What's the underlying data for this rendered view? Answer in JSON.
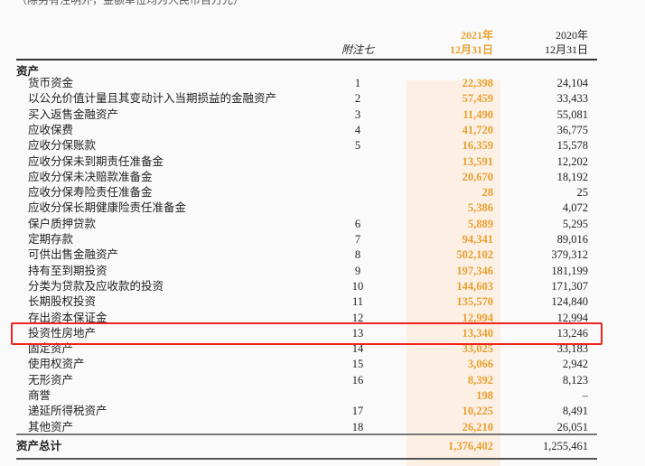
{
  "note": "（除另有注明外，金额单位均为人民币百万元）",
  "header": {
    "note_col": "附注七",
    "y2021": "2021年",
    "d2021": "12月31日",
    "y2020": "2020年",
    "d2020": "12月31日"
  },
  "section": "资产",
  "rows": [
    [
      "货币资金",
      "1",
      "22,398",
      "24,104"
    ],
    [
      "以公允价值计量且其变动计入当期损益的金融资产",
      "2",
      "57,459",
      "33,433"
    ],
    [
      "买入返售金融资产",
      "3",
      "11,490",
      "55,081"
    ],
    [
      "应收保费",
      "4",
      "41,720",
      "36,775"
    ],
    [
      "应收分保账款",
      "5",
      "16,359",
      "15,578"
    ],
    [
      "应收分保未到期责任准备金",
      "",
      "13,591",
      "12,202"
    ],
    [
      "应收分保未决赔款准备金",
      "",
      "20,670",
      "18,192"
    ],
    [
      "应收分保寿险责任准备金",
      "",
      "28",
      "25"
    ],
    [
      "应收分保长期健康险责任准备金",
      "",
      "5,386",
      "4,072"
    ],
    [
      "保户质押贷款",
      "6",
      "5,889",
      "5,295"
    ],
    [
      "定期存款",
      "7",
      "94,341",
      "89,016"
    ],
    [
      "可供出售金融资产",
      "8",
      "502,102",
      "379,312"
    ],
    [
      "持有至到期投资",
      "9",
      "197,346",
      "181,199"
    ],
    [
      "分类为贷款及应收款的投资",
      "10",
      "144,603",
      "171,307"
    ],
    [
      "长期股权投资",
      "11",
      "135,570",
      "124,840"
    ],
    [
      "存出资本保证金",
      "12",
      "12,994",
      "12,994"
    ],
    [
      "投资性房地产",
      "13",
      "13,340",
      "13,246"
    ],
    [
      "固定资产",
      "14",
      "33,025",
      "33,183"
    ],
    [
      "使用权资产",
      "15",
      "3,066",
      "2,942"
    ],
    [
      "无形资产",
      "16",
      "8,392",
      "8,123"
    ],
    [
      "商誉",
      "",
      "198",
      "–"
    ],
    [
      "递延所得税资产",
      "17",
      "10,225",
      "8,491"
    ],
    [
      "其他资产",
      "18",
      "26,210",
      "26,051"
    ]
  ],
  "total": {
    "label": "资产总计",
    "a": "1,376,402",
    "b": "1,255,461"
  },
  "colors": {
    "accent": "#e8a030",
    "highlight": "#fcefe4",
    "box": "#f0231f"
  }
}
